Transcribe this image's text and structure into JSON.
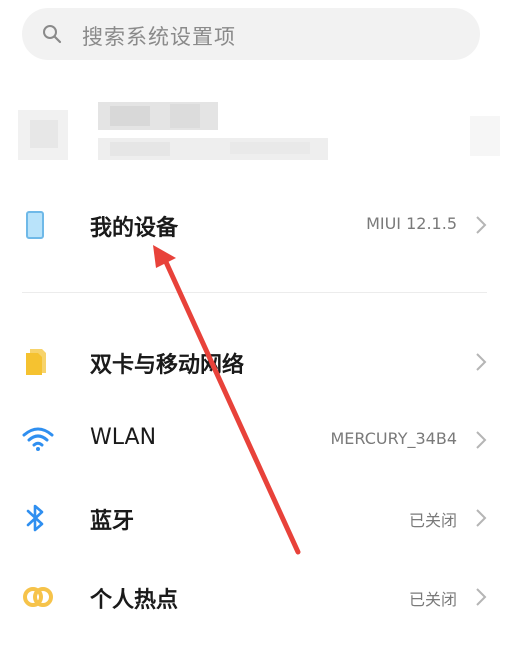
{
  "search": {
    "placeholder": "搜索系统设置项",
    "icon": "search-icon"
  },
  "colors": {
    "accent_blue": "#2f8ff0",
    "sim_yellow": "#f5c230",
    "hotspot_yellow": "#f6c34a",
    "device_blue": "#8fd0f5",
    "annotation_red": "#e8423a"
  },
  "settings": {
    "my_device": {
      "label": "我的设备",
      "value": "MIUI 12.1.5",
      "icon": "device-icon"
    },
    "sim": {
      "label": "双卡与移动网络",
      "value": "",
      "icon": "sim-card-icon"
    },
    "wlan": {
      "label": "WLAN",
      "value": "MERCURY_34B4",
      "icon": "wifi-icon"
    },
    "bluetooth": {
      "label": "蓝牙",
      "value": "已关闭",
      "icon": "bluetooth-icon"
    },
    "hotspot": {
      "label": "个人热点",
      "value": "已关闭",
      "icon": "hotspot-icon"
    }
  }
}
